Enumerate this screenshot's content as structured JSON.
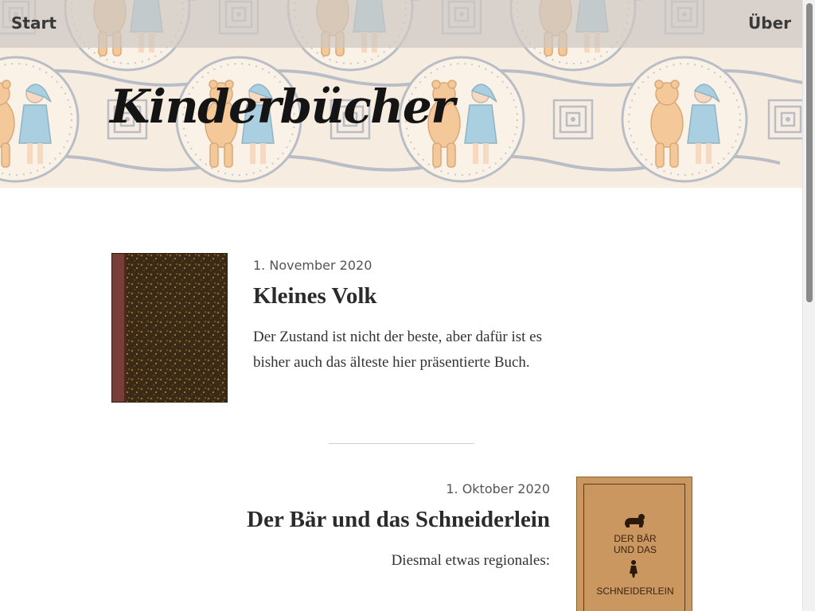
{
  "nav": {
    "start_label": "Start",
    "about_label": "Über"
  },
  "header": {
    "site_title": "Kinderbücher"
  },
  "posts": [
    {
      "date": "1. November 2020",
      "title": "Kleines Volk",
      "excerpt": "Der Zustand ist nicht der beste, aber dafür ist es bisher auch das älteste hier präsentierte Buch.",
      "cover": "worn brown book cover"
    },
    {
      "date": "1. Oktober 2020",
      "title": "Der Bär und das Schneiderlein",
      "excerpt": "Diesmal etwas regionales:",
      "cover": {
        "line1": "DER BÄR",
        "line2": "UND DAS",
        "line3": "SCHNEIDERLEIN",
        "icons": [
          "bear-icon",
          "tailor-figure-icon"
        ]
      }
    }
  ],
  "colors": {
    "banner_background": "#f7ece0",
    "topbar_overlay": "#cdc8c3",
    "title_text": "#141414",
    "bear_fill": "#f5c89a",
    "child_dress": "#a9cfe0",
    "pattern_lines": "#b9bec6"
  }
}
